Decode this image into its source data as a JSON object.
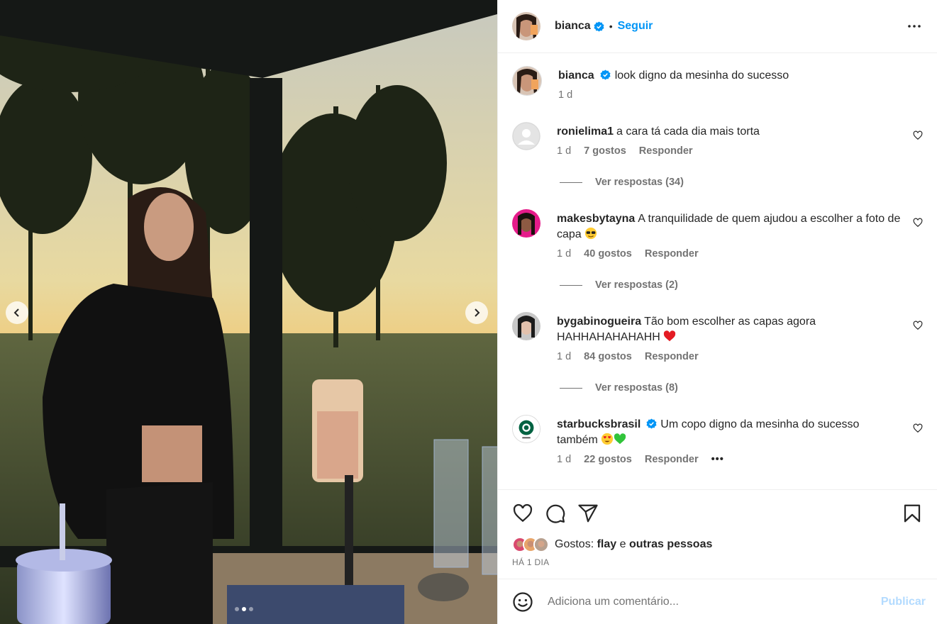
{
  "post": {
    "author": "bianca",
    "follow_label": "Seguir",
    "separator": "•",
    "caption": "look digno da mesinha do sucesso",
    "caption_time": "1 d"
  },
  "comments": [
    {
      "user": "ronielima1",
      "text": "a cara tá cada dia mais torta",
      "time": "1 d",
      "likes": "7 gostos",
      "reply": "Responder",
      "view_replies": "Ver respostas (34)",
      "verified": false
    },
    {
      "user": "makesbytayna",
      "text": "A tranquilidade de quem ajudou a escolher a foto de capa",
      "emoji": "sunglasses-emoji",
      "time": "1 d",
      "likes": "40 gostos",
      "reply": "Responder",
      "view_replies": "Ver respostas (2)",
      "verified": false
    },
    {
      "user": "bygabinogueira",
      "text": "Tão bom escolher as capas agora HAHHAHAHAHAHH",
      "emoji": "red-heart-emoji",
      "time": "1 d",
      "likes": "84 gostos",
      "reply": "Responder",
      "view_replies": "Ver respostas (8)",
      "verified": false
    },
    {
      "user": "starbucksbrasil",
      "text": "Um copo digno da mesinha do sucesso também",
      "emoji": "heart-eyes-emoji, green-heart-emoji",
      "time": "1 d",
      "likes": "22 gostos",
      "reply": "Responder",
      "more": "•••",
      "verified": true
    }
  ],
  "likes": {
    "prefix": "Gostos:",
    "first_liker": "flay",
    "conj": "e",
    "others": "outras pessoas"
  },
  "timestamp": "HÁ 1 DIA",
  "composer": {
    "placeholder": "Adiciona um comentário...",
    "publish": "Publicar"
  },
  "colors": {
    "accent": "#0095f6",
    "verified": "#0095f6",
    "publish_disabled": "#b3dbff",
    "muted": "#737373"
  },
  "icons": [
    "chevron-left-icon",
    "chevron-right-icon",
    "more-icon",
    "heart-icon",
    "comment-icon",
    "share-icon",
    "bookmark-icon",
    "emoji-icon",
    "verified-badge-icon"
  ]
}
